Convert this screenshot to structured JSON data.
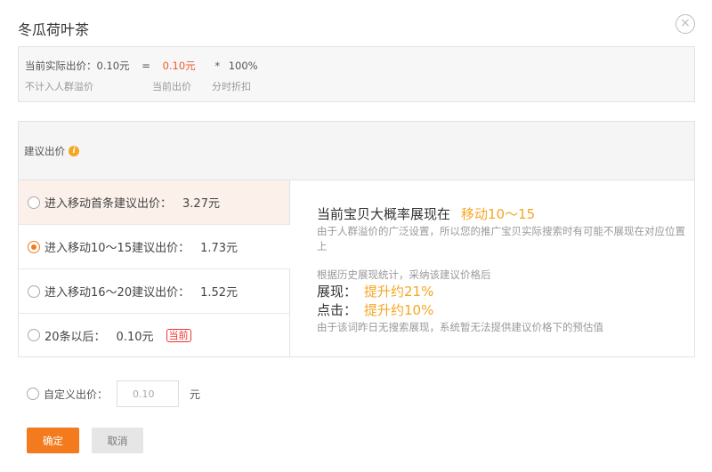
{
  "title": "冬瓜荷叶茶",
  "summary": {
    "actual_label": "当前实际出价：0.10元",
    "equals": "=",
    "current_price": "0.10元",
    "times": "*",
    "discount": "100%",
    "note1": "不计入人群溢价",
    "note2": "当前出价",
    "note3": "分时折扣"
  },
  "suggest": {
    "header": "建议出价",
    "options": [
      {
        "label": "进入移动首条建议出价：",
        "price": "3.27元",
        "checked": false
      },
      {
        "label": "进入移动10～15建议出价：",
        "price": "1.73元",
        "checked": true
      },
      {
        "label": "进入移动16～20建议出价：",
        "price": "1.52元",
        "checked": false
      },
      {
        "label": "20条以后：",
        "price": "0.10元",
        "badge": "当前",
        "checked": false
      }
    ]
  },
  "panel": {
    "title": "当前宝贝大概率展现在",
    "position": "移动10～15",
    "desc": "由于人群溢价的广泛设置，所以您的推广宝贝实际搜索时有可能不展现在对应位置上",
    "history": "根据历史展现统计，采纳该建议价格后",
    "impr_label": "展现：",
    "impr_value": "提升约21%",
    "click_label": "点击：",
    "click_value": "提升约10%",
    "footnote": "由于该词昨日无搜索展现，系统暂无法提供建议价格下的预估值"
  },
  "custom": {
    "label": "自定义出价：",
    "value": "0.10",
    "unit": "元"
  },
  "buttons": {
    "ok": "确定",
    "cancel": "取消"
  },
  "colors": {
    "accent": "#f37b1d",
    "highlight": "#f5a623",
    "red": "#f0592a"
  }
}
